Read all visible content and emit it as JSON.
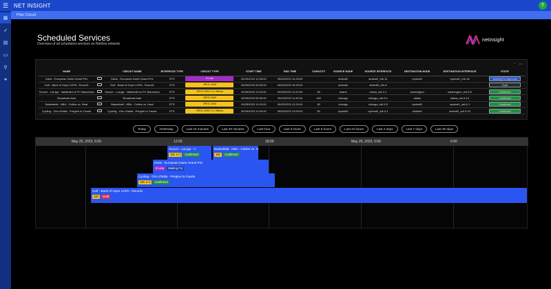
{
  "app": {
    "title": "NET INSIGHT",
    "user_initial": "T",
    "menu_icon": "hamburger-icon"
  },
  "subbar": {
    "label": "Plan Circuit"
  },
  "nav": [
    "calendar-icon",
    "rocket-icon",
    "grid-icon",
    "video-icon",
    "tree-icon",
    "link-icon"
  ],
  "page": {
    "title": "Scheduled Services",
    "subtitle": "Overview of all scheduled services on Nimbra network"
  },
  "logo": {
    "text": "netinsight"
  },
  "colors": {
    "accent": "#1a47c9",
    "eline": "#a52bc9",
    "jpeg": "#f4c21a",
    "confirmed": "#1f8f3a",
    "waiting": "#2a4fd0",
    "draft": "#2a2a2a"
  },
  "table": {
    "columns": [
      "NAME",
      "",
      "CIRCUIT NAME",
      "INTERFACE TYPE",
      "CIRCUIT TYPE",
      "START TIME",
      "END TIME",
      "CAPACITY",
      "SOURCE NODE",
      "SOURCE INTERFACE",
      "DESTINATION NODE",
      "DESTINATION INTERFACE",
      "STATE"
    ],
    "rows": [
      {
        "name": "Darts - European Darts Grand Prix",
        "circuit": "Darts - European Darts Grand Prix",
        "iface": "ETS",
        "ctype": "E-Line",
        "ctype_color": "#a52bc9",
        "start": "05/25/2023 10:25:00",
        "end": "05/26/2023 15:25:00",
        "cap": "",
        "snode": "stoleaf2",
        "siface": "stoleaf2_eth-11",
        "dnode": "nycleaf1",
        "diface": "nycleaf1_eth-18",
        "state": "Waiting For Approval",
        "state_color": "#2a4fd0"
      },
      {
        "name": "Golf - Bank of Hope LGPA - Round1",
        "circuit": "Golf - Bank of Hope LGPA - Round1",
        "iface": "ETS",
        "ctype": "JPEG 2000",
        "ctype_color": "#f4c21a",
        "start": "05/25/2023 06:25:00",
        "end": "05/26/2023 15:25:00",
        "cap": "",
        "snode": "stoleaf2",
        "siface": "stoleaf2_eth-6",
        "dnode": "",
        "diface": "",
        "state": "Draft",
        "state_color": "#2a2a2a"
      },
      {
        "name": "Soccer - LaLiga - Valladolid vs FC Barcelona",
        "circuit": "Soccer - LaLiga - Valladolid vs FC Barcelona",
        "iface": "ETS",
        "ctype": "JPEG 2000 1+1 Hitless",
        "ctype_color": "#f4c21a",
        "start": "05/25/2023 11:00:00",
        "end": "05/25/2023 11:20:00",
        "cap": "50",
        "snode": "miami",
        "siface": "miami_sdi-3-1",
        "dnode": "washington",
        "diface": "washington_sdi-3-5",
        "state": "Confirmed",
        "state_color": "#1f8f3a"
      },
      {
        "name": "Broadcast Asia",
        "circuit": "Broadcast Asia",
        "iface": "ETS",
        "ctype": "JPEG 2000",
        "ctype_color": "#f4c21a",
        "start": "05/25/2023 06:30:00",
        "end": "05/24/2023 11:30:00",
        "cap": "150",
        "snode": "chicago",
        "siface": "chicago_sdi-3-1",
        "dnode": "dallas",
        "diface": "dallas_sdi-3-10",
        "state": "Confirmed",
        "state_color": "#1f8f3a"
      },
      {
        "name": "Basketball - NBA - Celtics vs. Heat",
        "circuit": "Basketball - NBA - Celtics vs. Heat",
        "iface": "ETS",
        "ctype": "JPEG 2000",
        "ctype_color": "#f4c21a",
        "start": "05/25/2023 11:20:00",
        "end": "05/25/2023 12:20:00",
        "cap": "50",
        "snode": "chicago",
        "siface": "chicago_sdi-3-5",
        "dnode": "nycleaf1",
        "diface": "nycleaf1_sdi-6-1",
        "state": "Confirmed",
        "state_color": "#1f8f3a"
      },
      {
        "name": "Cycling - Giro d'Italia - Pergine to Caorle",
        "circuit": "Cycling - Giro d'Italia - Pergine to Caorle",
        "iface": "ETS",
        "ctype": "JPEG 2000 1+1 Hitless",
        "ctype_color": "#f4c21a",
        "start": "05/25/2023 10:00:00",
        "end": "05/25/2023 13:00:00",
        "cap": "50",
        "snode": "nycleaf2",
        "siface": "nycleaf2_sdi-3-1",
        "dnode": "stoleaf2",
        "diface": "stoleaf2_sdi-3-15",
        "state": "Confirmed",
        "state_color": "#1f8f3a"
      }
    ]
  },
  "filters": [
    "Today",
    "Yesterday",
    "Last 15 minutes",
    "Last 30 minutes",
    "Last hour",
    "Last 3 hours",
    "Last 6 hours",
    "Last 24 hours",
    "Last 2 days",
    "Last 7 days",
    "Last 30 days"
  ],
  "timeline": {
    "labels": [
      "May 25, 2023, 6:00",
      "12:00",
      "18:00",
      "May 26, 2023, 0:00",
      "6:00"
    ],
    "events": [
      {
        "title": "Soccer - LaLiga - V",
        "badges": [
          {
            "text": "J2K 1+1",
            "bg": "#f4c21a",
            "fg": "#111"
          },
          {
            "text": "Confirmed",
            "bg": "#1f8f3a",
            "fg": "#fff"
          }
        ]
      },
      {
        "title": "Basketball - NBA - Celtics vs. H",
        "badges": [
          {
            "text": "J2K",
            "bg": "#f4c21a",
            "fg": "#111"
          },
          {
            "text": "Confirmed",
            "bg": "#1f8f3a",
            "fg": "#fff"
          }
        ]
      },
      {
        "title": "Darts - European Darts Grand Prix",
        "badges": [
          {
            "text": "E-Line",
            "bg": "#a52bc9",
            "fg": "#fff"
          },
          {
            "text": "Waiting For",
            "bg": "#1a3fae",
            "fg": "#fff"
          }
        ]
      },
      {
        "title": "Cycling - Giro d'Italia - Pergine to Caorle",
        "badges": [
          {
            "text": "J2K 1+1",
            "bg": "#f4c21a",
            "fg": "#111"
          },
          {
            "text": "Confirmed",
            "bg": "#1f8f3a",
            "fg": "#fff"
          }
        ]
      },
      {
        "title": "Golf - Bank of Hope LGPA - Round1",
        "badges": [
          {
            "text": "J2K",
            "bg": "#f4c21a",
            "fg": "#111"
          },
          {
            "text": "Draft",
            "bg": "#e0303a",
            "fg": "#fff"
          }
        ]
      }
    ]
  }
}
